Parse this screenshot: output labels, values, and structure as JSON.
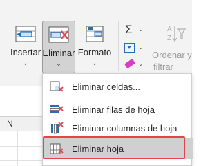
{
  "ribbon": {
    "insertar": {
      "label": "Insertar"
    },
    "eliminar": {
      "label": "Eliminar"
    },
    "formato": {
      "label": "Formato"
    },
    "sort_filter": {
      "label_line1": "Ordenar y",
      "label_line2": "filtrar"
    },
    "group_label_partial": "ió",
    "chevron": "⌄",
    "sigma": "Σ"
  },
  "grid": {
    "column_header": "N"
  },
  "menu": {
    "items": [
      {
        "label": "Eliminar celdas...",
        "icon": "delete-cells-icon"
      },
      {
        "label": "Eliminar filas de hoja",
        "icon": "delete-rows-icon"
      },
      {
        "label": "Eliminar columnas de hoja",
        "icon": "delete-columns-icon"
      },
      {
        "label": "Eliminar hoja",
        "icon": "delete-sheet-icon",
        "highlighted": true
      }
    ]
  },
  "colors": {
    "accent_blue": "#2b6cb0",
    "delete_red": "#e2454c",
    "ribbon_bg": "#f3f3f3",
    "menu_hover": "#d0d0d0"
  }
}
